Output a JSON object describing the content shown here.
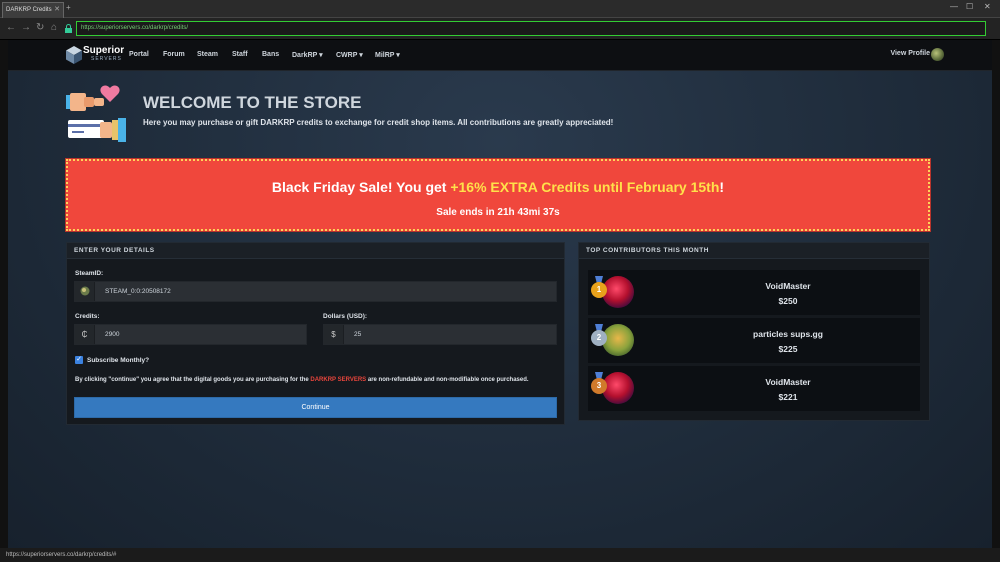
{
  "browser": {
    "tab_title": "DARKRP Credits",
    "url": "https://superiorservers.co/darkrp/credits/",
    "status_url": "https://superiorservers.co/darkrp/credits/#"
  },
  "nav": {
    "logo_text": "Superior",
    "logo_sub": "SERVERS",
    "links": [
      "Portal",
      "Forum",
      "Steam",
      "Staff",
      "Bans",
      "DarkRP ▾",
      "CWRP ▾",
      "MilRP ▾"
    ],
    "profile_label": "View Profile"
  },
  "hero": {
    "title": "WELCOME TO THE STORE",
    "subtitle": "Here you may purchase or gift DARKRP credits to exchange for credit shop items. All contributions are greatly appreciated!"
  },
  "sale": {
    "prefix": "Black Friday Sale! You get ",
    "highlight": "+16% EXTRA Credits until February 15th",
    "suffix": "!",
    "countdown": "Sale ends in 21h 43mi 37s"
  },
  "details": {
    "header": "ENTER YOUR DETAILS",
    "steamid_label": "SteamID:",
    "steamid_value": "STEAM_0:0:20508172",
    "credits_label": "Credits:",
    "credits_addon": "₵",
    "credits_value": "2900",
    "dollars_label": "Dollars (USD):",
    "dollars_addon": "$",
    "dollars_value": "25",
    "subscribe_label": "Subscribe Monthly?",
    "subscribe_checked": true,
    "terms_prefix": "By clicking \"continue\" you agree that the digital goods you are purchasing for the ",
    "terms_highlight": "DARKRP SERVERS",
    "terms_suffix": " are non-refundable and non-modifiable once purchased.",
    "continue_label": "Continue"
  },
  "contributors": {
    "header": "TOP CONTRIBUTORS THIS MONTH",
    "items": [
      {
        "rank": "1",
        "name": "VoidMaster",
        "amount": "$250",
        "medal_color": "#e8a21c"
      },
      {
        "rank": "2",
        "name": "particles sups.gg",
        "amount": "$225",
        "medal_color": "#9fb0c2"
      },
      {
        "rank": "3",
        "name": "VoidMaster",
        "amount": "$221",
        "medal_color": "#d07a2b"
      }
    ]
  },
  "colors": {
    "sale_bg": "#f0473c",
    "sale_highlight": "#ffe14a",
    "accent_blue": "#3579bf",
    "terms_red": "#e8453c"
  }
}
